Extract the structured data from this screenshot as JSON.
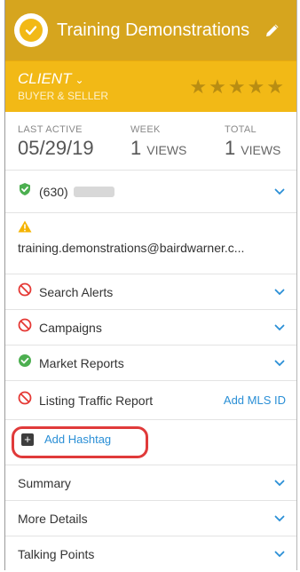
{
  "header": {
    "title": "Training Demonstrations",
    "badge_icon": "check-shield-icon",
    "edit_icon": "pencil-icon",
    "bg": "#d6a51e"
  },
  "client": {
    "type": "CLIENT",
    "subtitle": "BUYER & SELLER",
    "stars": "★★★★★",
    "bg": "#f2b916"
  },
  "stats": {
    "last_active_label": "LAST ACTIVE",
    "last_active_value": "05/29/19",
    "week_label": "WEEK",
    "week_value": "1",
    "week_unit": "VIEWS",
    "total_label": "TOTAL",
    "total_value": "1",
    "total_unit": "VIEWS"
  },
  "contact": {
    "phone_prefix": "(630)",
    "email": "training.demonstrations@bairdwarner.c..."
  },
  "items": [
    {
      "label": "Search Alerts"
    },
    {
      "label": "Campaigns"
    },
    {
      "label": "Market Reports"
    },
    {
      "label": "Listing Traffic Report",
      "action": "Add MLS ID"
    }
  ],
  "hashtag": {
    "label": "Add Hashtag"
  },
  "sections": [
    {
      "label": "Summary"
    },
    {
      "label": "More Details"
    },
    {
      "label": "Talking Points"
    }
  ],
  "colors": {
    "link": "#2a8fd6",
    "green": "#4caf50",
    "red": "#e53935",
    "warning": "#f5b400"
  }
}
